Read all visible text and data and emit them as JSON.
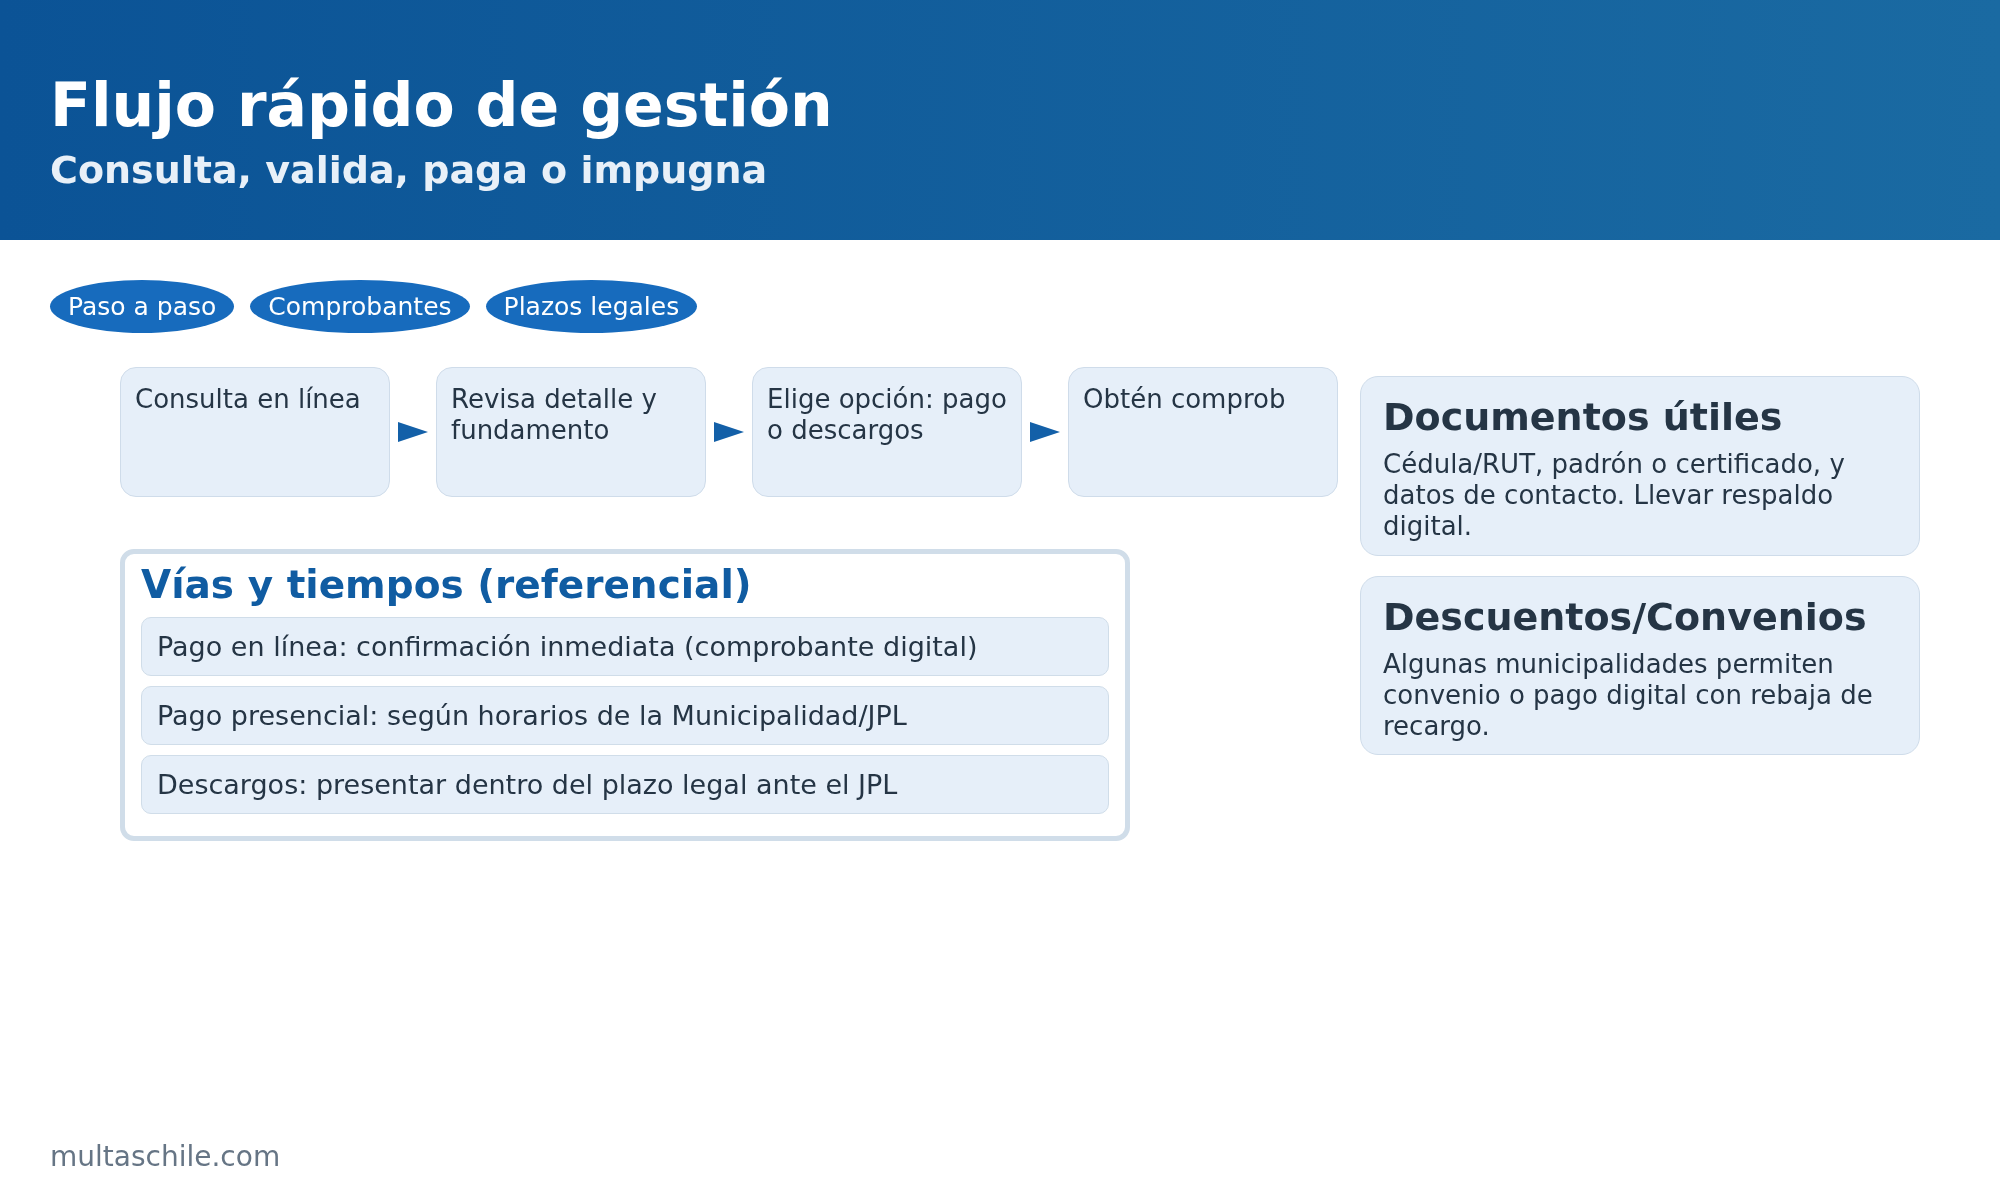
{
  "header": {
    "title": "Flujo rápido de gestión",
    "subtitle": "Consulta, valida, paga o impugna"
  },
  "tags": [
    "Paso a paso",
    "Comprobantes",
    "Plazos legales"
  ],
  "steps": [
    "Consulta en línea",
    "Revisa detalle y fundamento",
    "Elige opción: pago o descargos",
    "Obtén comprob"
  ],
  "timing_panel": {
    "title": "Vías y tiempos (referencial)",
    "items": [
      "Pago en línea: confirmación inmediata (comprobante digital)",
      "Pago presencial: según horarios de la Municipalidad/JPL",
      "Descargos: presentar dentro del plazo legal ante el JPL"
    ]
  },
  "info_cards": [
    {
      "title": "Documentos útiles",
      "text": "Cédula/RUT, padrón o certificado, y datos de contacto. Llevar respaldo digital."
    },
    {
      "title": "Descuentos/Convenios",
      "text": "Algunas municipalidades permiten convenio o pago digital con rebaja de recargo."
    }
  ],
  "footer": "multaschile.com"
}
